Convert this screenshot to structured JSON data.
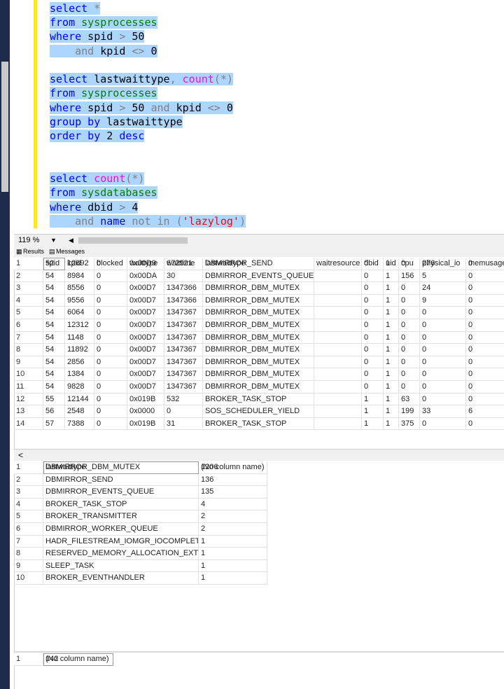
{
  "editor": {
    "lines": [
      {
        "segs": [
          [
            "kw",
            "select"
          ],
          [
            "gry",
            " *"
          ]
        ]
      },
      {
        "segs": [
          [
            "kw",
            "from"
          ],
          [
            "blk",
            " "
          ],
          [
            "grn",
            "sysprocesses"
          ]
        ]
      },
      {
        "segs": [
          [
            "kw",
            "where"
          ],
          [
            "blk",
            " spid "
          ],
          [
            "gry",
            ">"
          ],
          [
            "blk",
            " 50"
          ]
        ]
      },
      {
        "segs": [
          [
            "blk",
            "    "
          ],
          [
            "gry",
            "and"
          ],
          [
            "blk",
            " kpid "
          ],
          [
            "gry",
            "<>"
          ],
          [
            "blk",
            " 0"
          ]
        ]
      },
      {
        "segs": []
      },
      {
        "segs": [
          [
            "kw",
            "select"
          ],
          [
            "blk",
            " lastwaittype"
          ],
          [
            "gry",
            ","
          ],
          [
            "blk",
            " "
          ],
          [
            "pink",
            "count"
          ],
          [
            "gry",
            "(*)"
          ]
        ]
      },
      {
        "segs": [
          [
            "kw",
            "from"
          ],
          [
            "blk",
            " "
          ],
          [
            "grn",
            "sysprocesses"
          ]
        ]
      },
      {
        "segs": [
          [
            "kw",
            "where"
          ],
          [
            "blk",
            " spid "
          ],
          [
            "gry",
            ">"
          ],
          [
            "blk",
            " 50 "
          ],
          [
            "gry",
            "and"
          ],
          [
            "blk",
            " kpid "
          ],
          [
            "gry",
            "<>"
          ],
          [
            "blk",
            " 0"
          ]
        ]
      },
      {
        "segs": [
          [
            "kw",
            "group by"
          ],
          [
            "blk",
            " lastwaittype"
          ]
        ]
      },
      {
        "segs": [
          [
            "kw",
            "order by"
          ],
          [
            "blk",
            " 2 "
          ],
          [
            "kw",
            "desc"
          ]
        ]
      },
      {
        "segs": []
      },
      {
        "segs": []
      },
      {
        "segs": [
          [
            "kw",
            "select"
          ],
          [
            "blk",
            " "
          ],
          [
            "pink",
            "count"
          ],
          [
            "gry",
            "(*)"
          ]
        ]
      },
      {
        "segs": [
          [
            "kw",
            "from"
          ],
          [
            "blk",
            " "
          ],
          [
            "grn",
            "sysdatabases"
          ]
        ]
      },
      {
        "segs": [
          [
            "kw",
            "where"
          ],
          [
            "blk",
            " dbid "
          ],
          [
            "gry",
            ">"
          ],
          [
            "blk",
            " 4"
          ]
        ]
      },
      {
        "segs": [
          [
            "blk",
            "    "
          ],
          [
            "gry",
            "and"
          ],
          [
            "blk",
            " "
          ],
          [
            "kw",
            "name"
          ],
          [
            "blk",
            " "
          ],
          [
            "gry",
            "not in"
          ],
          [
            "blk",
            " "
          ],
          [
            "gry",
            "("
          ],
          [
            "red",
            "'lazylog'"
          ],
          [
            "gry",
            ")"
          ]
        ]
      }
    ]
  },
  "zoom": {
    "level": "119 %",
    "dropdown": "▼",
    "left_arrow": "◀"
  },
  "tabs": {
    "results": "Results",
    "messages": "Messages",
    "results_icon": "grid-icon",
    "messages_icon": "messages-icon"
  },
  "grid1": {
    "columns": [
      "spid",
      "kpid",
      "blocked",
      "waittype",
      "waittime",
      "lastwaittype",
      "waitresource",
      "dbid",
      "uid",
      "cpu",
      "physical_io",
      "memusage"
    ],
    "rows": [
      [
        "52",
        "12692",
        "0",
        "0x00D9",
        "672921",
        "DBMIRROR_SEND",
        "",
        "0",
        "1",
        "0",
        "276",
        "0"
      ],
      [
        "54",
        "8984",
        "0",
        "0x00DA",
        "30",
        "DBMIRROR_EVENTS_QUEUE",
        "",
        "0",
        "1",
        "156",
        "5",
        "0"
      ],
      [
        "54",
        "8556",
        "0",
        "0x00D7",
        "1347366",
        "DBMIRROR_DBM_MUTEX",
        "",
        "0",
        "1",
        "0",
        "24",
        "0"
      ],
      [
        "54",
        "9556",
        "0",
        "0x00D7",
        "1347366",
        "DBMIRROR_DBM_MUTEX",
        "",
        "0",
        "1",
        "0",
        "9",
        "0"
      ],
      [
        "54",
        "6064",
        "0",
        "0x00D7",
        "1347367",
        "DBMIRROR_DBM_MUTEX",
        "",
        "0",
        "1",
        "0",
        "0",
        "0"
      ],
      [
        "54",
        "12312",
        "0",
        "0x00D7",
        "1347367",
        "DBMIRROR_DBM_MUTEX",
        "",
        "0",
        "1",
        "0",
        "0",
        "0"
      ],
      [
        "54",
        "1148",
        "0",
        "0x00D7",
        "1347367",
        "DBMIRROR_DBM_MUTEX",
        "",
        "0",
        "1",
        "0",
        "0",
        "0"
      ],
      [
        "54",
        "11892",
        "0",
        "0x00D7",
        "1347367",
        "DBMIRROR_DBM_MUTEX",
        "",
        "0",
        "1",
        "0",
        "0",
        "0"
      ],
      [
        "54",
        "2856",
        "0",
        "0x00D7",
        "1347367",
        "DBMIRROR_DBM_MUTEX",
        "",
        "0",
        "1",
        "0",
        "0",
        "0"
      ],
      [
        "54",
        "1384",
        "0",
        "0x00D7",
        "1347367",
        "DBMIRROR_DBM_MUTEX",
        "",
        "0",
        "1",
        "0",
        "0",
        "0"
      ],
      [
        "54",
        "9828",
        "0",
        "0x00D7",
        "1347367",
        "DBMIRROR_DBM_MUTEX",
        "",
        "0",
        "1",
        "0",
        "0",
        "0"
      ],
      [
        "55",
        "12144",
        "0",
        "0x019B",
        "532",
        "BROKER_TASK_STOP",
        "",
        "1",
        "1",
        "63",
        "0",
        "0"
      ],
      [
        "56",
        "2548",
        "0",
        "0x0000",
        "0",
        "SOS_SCHEDULER_YIELD",
        "",
        "1",
        "1",
        "199",
        "33",
        "6"
      ],
      [
        "57",
        "7388",
        "0",
        "0x019B",
        "31",
        "BROKER_TASK_STOP",
        "",
        "1",
        "1",
        "375",
        "0",
        "0"
      ]
    ]
  },
  "grid2": {
    "columns": [
      "lastwaittype",
      "(No column name)"
    ],
    "rows": [
      [
        "DBMIRROR_DBM_MUTEX",
        "1206"
      ],
      [
        "DBMIRROR_SEND",
        "136"
      ],
      [
        "DBMIRROR_EVENTS_QUEUE",
        "135"
      ],
      [
        "BROKER_TASK_STOP",
        "4"
      ],
      [
        "BROKER_TRANSMITTER",
        "2"
      ],
      [
        "DBMIRROR_WORKER_QUEUE",
        "2"
      ],
      [
        "HADR_FILESTREAM_IOMGR_IOCOMPLETI",
        "1"
      ],
      [
        "RESERVED_MEMORY_ALLOCATION_EXT",
        "1"
      ],
      [
        "SLEEP_TASK",
        "1"
      ],
      [
        "BROKER_EVENTHANDLER",
        "1"
      ]
    ]
  },
  "grid3": {
    "columns": [
      "(No column name)"
    ],
    "rows": [
      [
        "142"
      ]
    ]
  }
}
